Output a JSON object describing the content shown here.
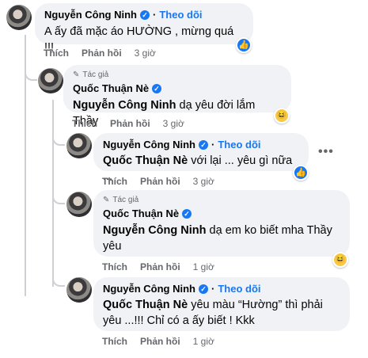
{
  "comments": [
    {
      "author": "Nguyễn Công Ninh",
      "follow": "Theo dõi",
      "text": "A ấy đã mặc áo HƯỜNG , mừng quá !!!",
      "like": "Thích",
      "reply": "Phản hồi",
      "time": "3 giờ",
      "reaction": "like"
    },
    {
      "badge": "Tác giả",
      "author": "Quốc Thuận Nè",
      "mention": "Nguyễn Công Ninh",
      "text": "dạ yêu đời lắm Thầy",
      "like": "Thích",
      "reply": "Phản hồi",
      "time": "3 giờ",
      "reaction": "haha"
    },
    {
      "author": "Nguyễn Công Ninh",
      "follow": "Theo dõi",
      "mention": "Quốc Thuận Nè",
      "text": "với lại ... yêu gì nữa ...",
      "like": "Thích",
      "reply": "Phản hồi",
      "time": "3 giờ",
      "reaction": "like",
      "more": "•••"
    },
    {
      "badge": "Tác giả",
      "author": "Quốc Thuận Nè",
      "mention": "Nguyễn Công Ninh",
      "text_line1": "dạ em ko biết mha Thầy",
      "text_line2": "yêu",
      "like": "Thích",
      "reply": "Phản hồi",
      "time": "1 giờ",
      "reaction": "haha"
    },
    {
      "author": "Nguyễn Công Ninh",
      "follow": "Theo dõi",
      "mention": "Quốc Thuận Nè",
      "text_line1": "yêu màu “Hường” thì phải",
      "text_line2": "yêu ...!!! Chỉ có a ấy biết ! Kkk",
      "like": "Thích",
      "reply": "Phản hồi",
      "time": "1 giờ"
    }
  ],
  "icons": {
    "verified": "verified-check-icon",
    "pen": "pencil-icon",
    "like_reaction": "thumbs-up-icon",
    "haha_reaction": "laughing-face-icon",
    "more": "more-options-icon"
  },
  "colors": {
    "bubble": "#f0f2f5",
    "link": "#1877f2",
    "meta": "#65676b"
  }
}
